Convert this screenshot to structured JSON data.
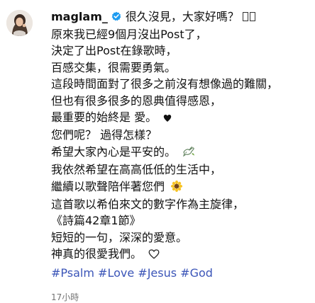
{
  "post": {
    "username": "maglam_",
    "first_line_text": "很久沒見，大家好嗎？",
    "caption_lines": [
      "原來我已經9個月沒出Post了，",
      "決定了出Post在錄歌時，",
      "百感交集，很需要勇氣。",
      "這段時間面對了很多之前沒有想像過的難關，",
      "但也有很多很多的恩典值得感恩，",
      "最重要的始終是 愛。",
      "您們呢？ 過得怎樣？",
      "希望大家內心是平安的。",
      "我依然希望在高高低低的生活中，",
      "繼續以歌聲陪伴著您們",
      "這首歌以希伯來文的數字作為主旋律，",
      "《詩篇42章1節》",
      "短短的一句，深深的愛意。",
      "神真的很愛我們。"
    ],
    "line_icons": {
      "love": "black-heart-icon",
      "peace": "dove-icon",
      "song": "sunflower-icon",
      "god": "white-heart-icon"
    },
    "hashtags": [
      "#Psalm",
      "#Love",
      "#Jesus",
      "#God"
    ],
    "timestamp": "17小時",
    "colors": {
      "hashtag": "#3b55b8",
      "verified_badge": "#1d9bf0",
      "timestamp": "#737373"
    }
  }
}
